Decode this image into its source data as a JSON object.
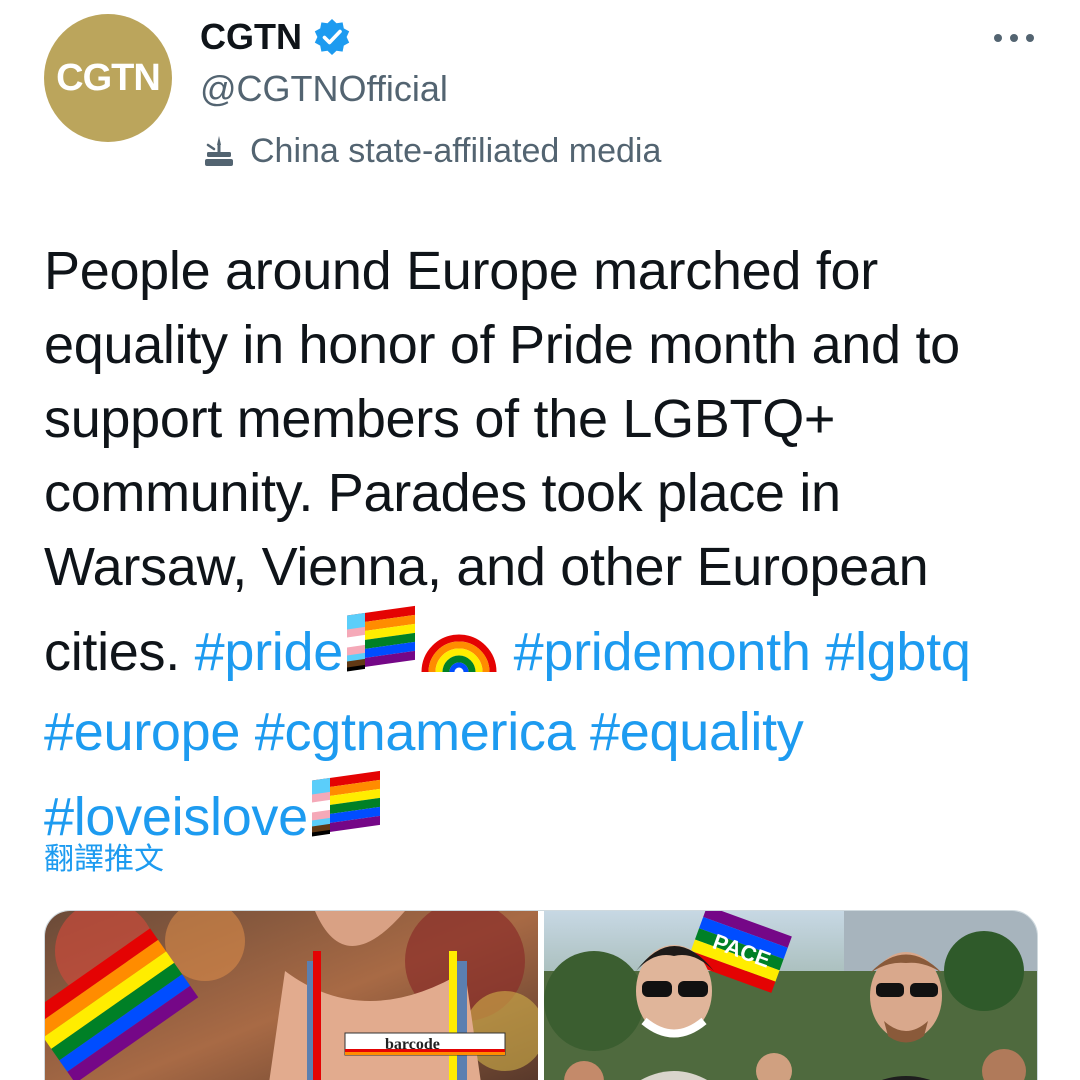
{
  "author": {
    "avatar_text": "CGTN",
    "display_name": "CGTN",
    "handle": "@CGTNOfficial",
    "label": "China state-affiliated media"
  },
  "tweet": {
    "text": "People around Europe marched for equality in honor of Pride month and to support members of the LGBTQ+ community. Parades took place in Warsaw, Vienna, and other European cities.",
    "hashtags": {
      "pride": "#pride",
      "pridemonth": "#pridemonth",
      "lgbtq": "#lgbtq",
      "europe": "#europe",
      "cgtnamerica": "#cgtnamerica",
      "equality": "#equality",
      "loveislove": "#loveislove"
    },
    "translate_label": "翻譯推文"
  },
  "media": {
    "image1_label": "barcode",
    "image2_label": "PACE"
  },
  "colors": {
    "accent": "#1d9bf0",
    "text": "#0f1419",
    "secondary": "#536471",
    "avatar_bg": "#bba55c"
  },
  "icons": {
    "verified": "verified-badge-icon",
    "affiliation": "state-media-icon",
    "more": "more-options-icon",
    "pride_flag": "progress-pride-flag-emoji",
    "rainbow": "rainbow-emoji"
  }
}
